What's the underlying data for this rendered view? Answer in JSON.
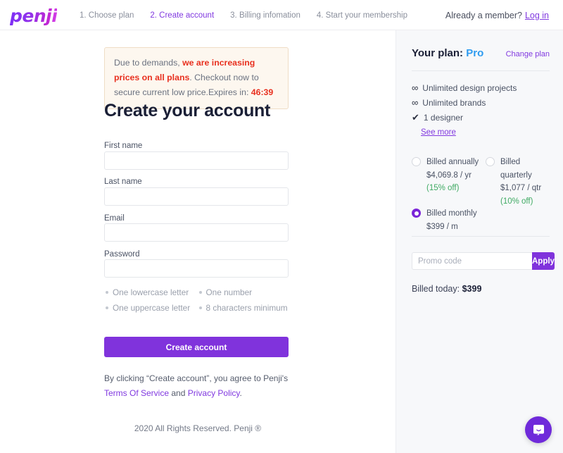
{
  "header": {
    "logo_text": "penji",
    "steps": [
      {
        "label": "1. Choose plan",
        "active": false
      },
      {
        "label": "2. Create account",
        "active": true
      },
      {
        "label": "3. Billing infomation",
        "active": false
      },
      {
        "label": "4. Start your membership",
        "active": false
      }
    ],
    "member_prompt": "Already a member?",
    "login_label": "Log in"
  },
  "alert": {
    "lead": "Due to demands,",
    "highlight": "we are increasing prices on all plans",
    "rest": ". Checkout now to secure current low price.Expires in:",
    "timer": "46:39"
  },
  "form": {
    "title": "Create your account",
    "fields": [
      {
        "label": "First name",
        "value": "",
        "placeholder": ""
      },
      {
        "label": "Last name",
        "value": "",
        "placeholder": ""
      },
      {
        "label": "Email",
        "value": "",
        "placeholder": ""
      },
      {
        "label": "Password",
        "value": "",
        "placeholder": ""
      }
    ],
    "password_rules": [
      "One lowercase letter",
      "One number",
      "One uppercase letter",
      "8 characters minimum"
    ],
    "submit_label": "Create account",
    "legal_prefix": "By clicking “Create account”, you agree to Penji's",
    "terms_label": "Terms Of Service",
    "legal_and": "and",
    "privacy_label": "Privacy Policy",
    "legal_suffix": "."
  },
  "footer": {
    "text": "2020 All Rights Reserved. Penji ®"
  },
  "sidebar": {
    "plan_label": "Your plan:",
    "plan_name": "Pro",
    "change_plan_label": "Change plan",
    "features": [
      {
        "icon": "infinity-icon",
        "glyph": "∞",
        "label": "Unlimited design projects"
      },
      {
        "icon": "infinity-icon",
        "glyph": "∞",
        "label": "Unlimited brands"
      },
      {
        "icon": "check-icon",
        "glyph": "✔",
        "label": "1 designer"
      }
    ],
    "see_more_label": "See more",
    "billing_options": [
      {
        "label": "Billed annually",
        "price": "$4,069.8 / yr",
        "discount": "(15% off)",
        "selected": false
      },
      {
        "label": "Billed quarterly",
        "price": "$1,077 / qtr",
        "discount": "(10% off)",
        "selected": false
      },
      {
        "label": "Billed monthly",
        "price": "$399 / m",
        "discount": "",
        "selected": true
      }
    ],
    "promo_placeholder": "Promo code",
    "promo_value": "",
    "apply_label": "Apply",
    "billed_today_label": "Billed today:",
    "billed_today_amount": "$399"
  },
  "chat": {
    "icon": "chat-bubble-icon"
  },
  "colors": {
    "brand_purple": "#8033dc",
    "link_purple": "#8139e0",
    "plan_blue": "#2e9bf0",
    "discount_green": "#3faa63",
    "alert_red": "#e8301f",
    "sidebar_bg": "#f7f8fa"
  }
}
